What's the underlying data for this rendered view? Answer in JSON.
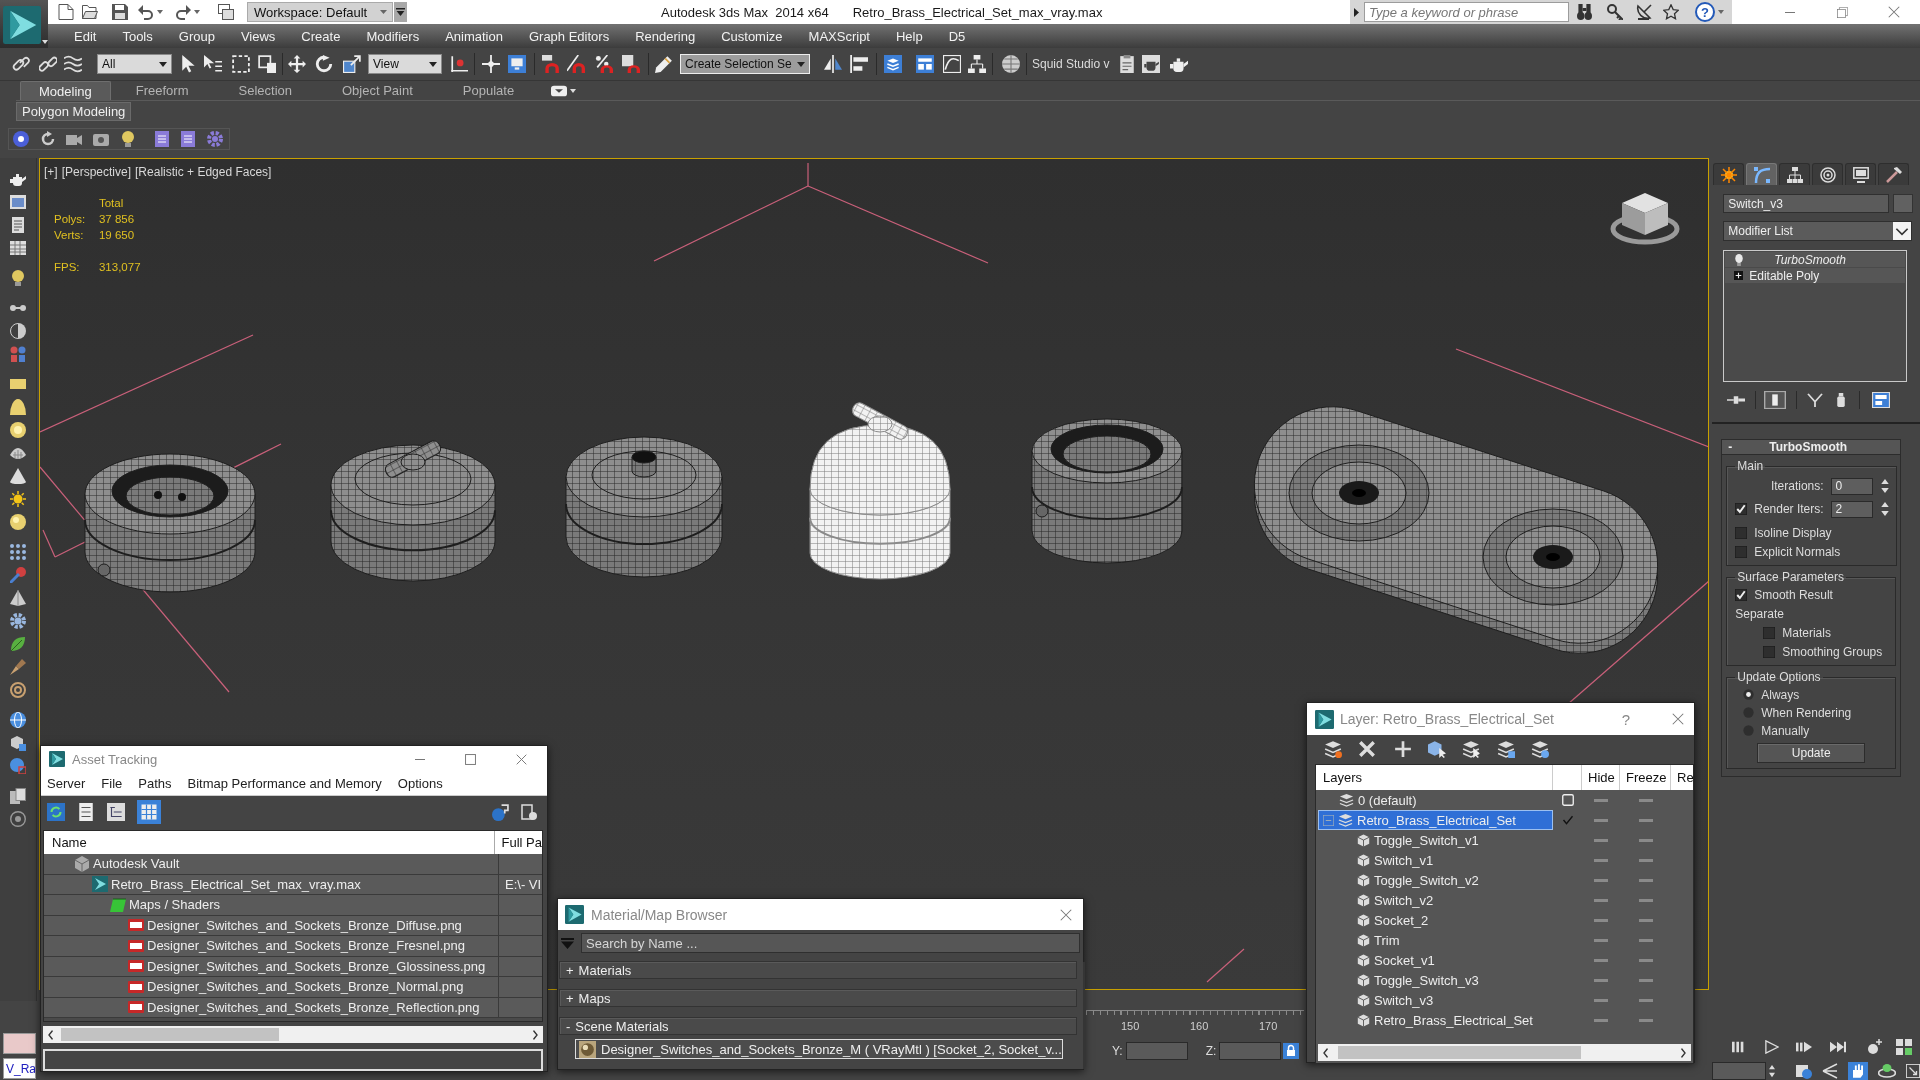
{
  "title_bar": {
    "workspace": "Workspace: Default",
    "app_name": "Autodesk 3ds Max  2014 x64",
    "file_name": "Retro_Brass_Electrical_Set_max_vray.max",
    "search": {
      "placeholder": "Type a keyword or phrase"
    },
    "help": "?"
  },
  "menu_bar": [
    "Edit",
    "Tools",
    "Group",
    "Views",
    "Create",
    "Modifiers",
    "Animation",
    "Graph Editors",
    "Rendering",
    "Customize",
    "MAXScript",
    "Help",
    "D5"
  ],
  "main_toolbar": {
    "selection_filter": "All",
    "reference_coordinate_system": "View",
    "named_selection_set": "Create Selection Se",
    "plugin": "Squid Studio v"
  },
  "ribbon": {
    "tabs": [
      {
        "label": "Modeling",
        "selected": true
      },
      {
        "label": "Freeform",
        "selected": false
      },
      {
        "label": "Selection",
        "selected": false
      },
      {
        "label": "Object Paint",
        "selected": false
      },
      {
        "label": "Populate",
        "selected": false
      }
    ],
    "panel": "Polygon Modeling"
  },
  "viewport": {
    "labels": [
      "[+]",
      "[Perspective]",
      "[Realistic + Edged Faces]"
    ],
    "stats": {
      "heading": "Total",
      "rows": [
        {
          "label": "Polys:",
          "value": "37 856"
        },
        {
          "label": "Verts:",
          "value": "19 650"
        }
      ],
      "fps": {
        "label": "FPS:",
        "value": "313,077"
      }
    },
    "objects": [
      {
        "kind": "socket",
        "selected": false
      },
      {
        "kind": "toggle",
        "selected": false
      },
      {
        "kind": "knob",
        "selected": false
      },
      {
        "kind": "toggle_dome",
        "selected": true
      },
      {
        "kind": "socket_tall",
        "selected": false
      },
      {
        "kind": "double_socket",
        "selected": false
      }
    ]
  },
  "command_panel": {
    "tabs": [
      {
        "kind": "create",
        "selected": false
      },
      {
        "kind": "modify",
        "selected": true
      },
      {
        "kind": "hierarchy",
        "selected": false
      },
      {
        "kind": "motion",
        "selected": false
      },
      {
        "kind": "display",
        "selected": false
      },
      {
        "kind": "utilities",
        "selected": false
      }
    ],
    "object_name": "Switch_v3",
    "modifier_list": "Modifier List",
    "stack": [
      {
        "kind": "modifier",
        "name": "TurboSmooth"
      },
      {
        "kind": "base",
        "name": "Editable Poly"
      }
    ],
    "rollout": {
      "toggle": "-",
      "title": "TurboSmooth",
      "groups": [
        {
          "title": "Main",
          "controls": [
            {
              "kind": "spinner",
              "label": "Iterations:",
              "value": "0"
            },
            {
              "kind": "check_spinner",
              "label": "Render Iters:",
              "checked": true,
              "value": "2"
            },
            {
              "kind": "checkbox",
              "label": "Isoline Display",
              "checked": false
            },
            {
              "kind": "checkbox",
              "label": "Explicit Normals",
              "checked": false
            }
          ]
        },
        {
          "title": "Surface Parameters",
          "controls": [
            {
              "kind": "checkbox",
              "label": "Smooth Result",
              "checked": true
            },
            {
              "kind": "label",
              "label": "Separate",
              "children": [
                {
                  "kind": "checkbox",
                  "label": "Materials",
                  "checked": false
                },
                {
                  "kind": "checkbox",
                  "label": "Smoothing Groups",
                  "checked": false
                }
              ]
            }
          ]
        },
        {
          "title": "Update Options",
          "controls": [
            {
              "kind": "radio",
              "label": "Always",
              "selected": true
            },
            {
              "kind": "radio",
              "label": "When Rendering",
              "selected": false
            },
            {
              "kind": "radio",
              "label": "Manually",
              "selected": false
            },
            {
              "kind": "button",
              "label": "Update"
            }
          ]
        }
      ]
    }
  },
  "asset_tracking": {
    "title": "Asset Tracking",
    "menu": [
      "Server",
      "File",
      "Paths",
      "Bitmap Performance and Memory",
      "Options"
    ],
    "toolbar": [
      {
        "kind": "refresh",
        "selected": false
      },
      {
        "kind": "list",
        "selected": false
      },
      {
        "kind": "tree",
        "selected": false
      },
      {
        "kind": "table",
        "selected": true
      }
    ],
    "columns": [
      "Name",
      "Full Pa"
    ],
    "tree": [
      {
        "kind": "vault",
        "name": "Autodesk Vault",
        "children": [
          {
            "kind": "scene",
            "name": "Retro_Brass_Electrical_Set_max_vray.max",
            "path": "E:\\- VI",
            "children": [
              {
                "kind": "folder",
                "name": "Maps / Shaders",
                "children": [
                  {
                    "kind": "png",
                    "name": "Designer_Switches_and_Sockets_Bronze_Diffuse.png"
                  },
                  {
                    "kind": "png",
                    "name": "Designer_Switches_and_Sockets_Bronze_Fresnel.png"
                  },
                  {
                    "kind": "png",
                    "name": "Designer_Switches_and_Sockets_Bronze_Glossiness.png"
                  },
                  {
                    "kind": "png",
                    "name": "Designer_Switches_and_Sockets_Bronze_Normal.png"
                  },
                  {
                    "kind": "png",
                    "name": "Designer_Switches_and_Sockets_Bronze_Reflection.png"
                  }
                ]
              }
            ]
          }
        ]
      }
    ]
  },
  "material_browser": {
    "title": "Material/Map Browser",
    "search": {
      "placeholder": "Search by Name ..."
    },
    "groups": [
      {
        "toggle": "+",
        "label": "Materials"
      },
      {
        "toggle": "+",
        "label": "Maps"
      },
      {
        "toggle": "-",
        "label": "Scene Materials",
        "items": [
          "Designer_Switches_and_Sockets_Bronze_M ( VRayMtl ) [Socket_2, Socket_v..."
        ]
      }
    ]
  },
  "layer_manager": {
    "title": "Layer: Retro_Brass_Electrical_Set",
    "help": "?",
    "columns": [
      "Layers",
      "Hide",
      "Freeze",
      "Re"
    ],
    "layers": [
      {
        "name": "0 (default)",
        "current": false,
        "selected": false
      },
      {
        "name": "Retro_Brass_Electrical_Set",
        "current": true,
        "selected": true,
        "children": [
          {
            "name": "Toggle_Switch_v1"
          },
          {
            "name": "Switch_v1"
          },
          {
            "name": "Toggle_Switch_v2"
          },
          {
            "name": "Switch_v2"
          },
          {
            "name": "Socket_2"
          },
          {
            "name": "Trim"
          },
          {
            "name": "Socket_v1"
          },
          {
            "name": "Toggle_Switch_v3"
          },
          {
            "name": "Switch_v3"
          },
          {
            "name": "Retro_Brass_Electrical_Set"
          }
        ]
      }
    ]
  },
  "timeline": {
    "ticks": [
      "150",
      "160",
      "170"
    ]
  },
  "status_bar": {
    "listener": "V_Ra",
    "coordinates": [
      {
        "label": "Y:"
      },
      {
        "label": "Z:"
      }
    ]
  }
}
